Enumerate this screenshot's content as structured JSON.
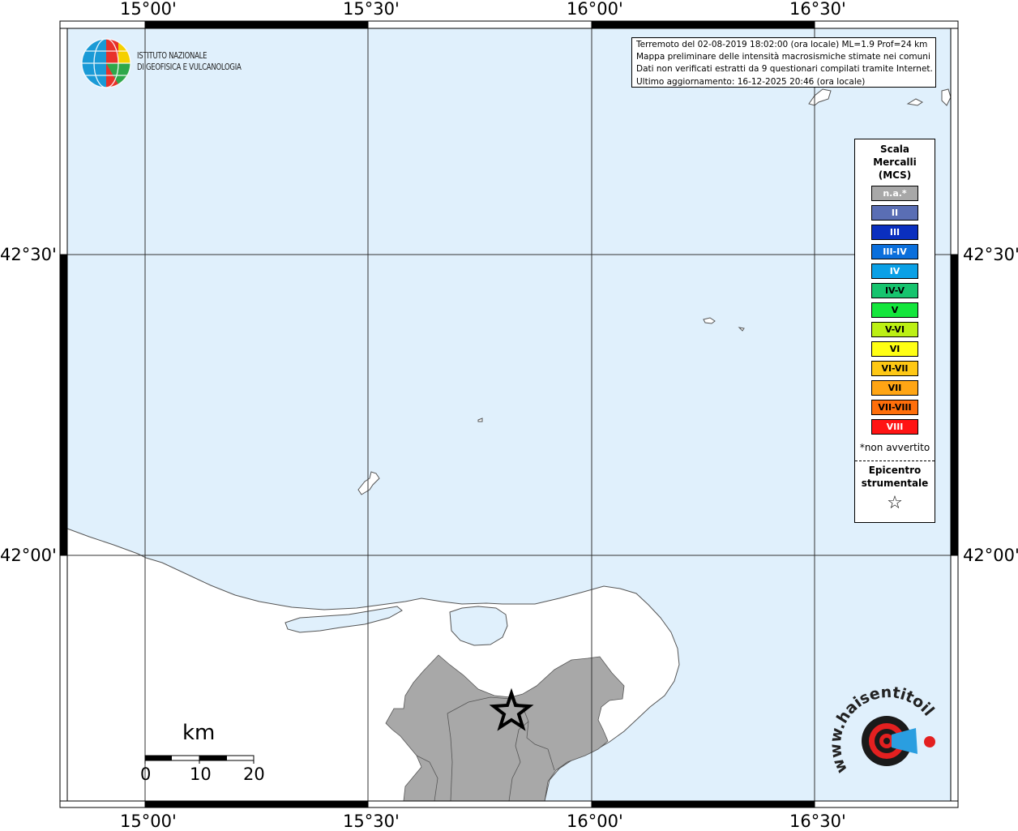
{
  "map": {
    "lon_labels": [
      "15°00'",
      "15°30'",
      "16°00'",
      "16°30'"
    ],
    "lat_labels": [
      "42°30'",
      "42°00'"
    ],
    "epicenter": {
      "symbol": "☆"
    }
  },
  "info_box": {
    "line1": "Terremoto del 02-08-2019 18:02:00 (ora locale) ML=1.9 Prof=24 km",
    "line2": "Mappa preliminare delle intensità macrosismiche stimate nei comuni",
    "line3": "Dati non verificati estratti da 9 questionari compilati tramite Internet.",
    "line4": "Ultimo aggiornamento: 16-12-2025 20:46 (ora locale)"
  },
  "institute_logo": {
    "line1": "ISTITUTO NAZIONALE",
    "line2": "DI GEOFISICA E VULCANOLOGIA"
  },
  "legend": {
    "title": [
      "Scala",
      "Mercalli",
      "(MCS)"
    ],
    "items": [
      {
        "label": "n.a.*",
        "color": "#a8a8a8"
      },
      {
        "label": "II",
        "color": "#5a6eb4"
      },
      {
        "label": "III",
        "color": "#0a2fbf"
      },
      {
        "label": "III-IV",
        "color": "#0a6fdc"
      },
      {
        "label": "IV",
        "color": "#0aa0e6"
      },
      {
        "label": "IV-V",
        "color": "#16c46e"
      },
      {
        "label": "V",
        "color": "#14e63c"
      },
      {
        "label": "V-VI",
        "color": "#bcf014"
      },
      {
        "label": "VI",
        "color": "#ffff14"
      },
      {
        "label": "VI-VII",
        "color": "#ffc814"
      },
      {
        "label": "VII",
        "color": "#ffa514"
      },
      {
        "label": "VII-VIII",
        "color": "#ff6e0a"
      },
      {
        "label": "VIII",
        "color": "#ff1414"
      }
    ],
    "footnote": "*non avvertito",
    "epicenter_label": [
      "Epicentro",
      "strumentale"
    ],
    "epicenter_symbol": "☆"
  },
  "scale_bar": {
    "unit": "km",
    "labels": [
      "0",
      "10",
      "20"
    ]
  },
  "hsit_logo": {
    "text": "www.haisentitoilterremoto.it"
  },
  "colors": {
    "sea": "#e0f0fc",
    "land": "#ffffff",
    "felt_area": "#a8a8a8"
  }
}
